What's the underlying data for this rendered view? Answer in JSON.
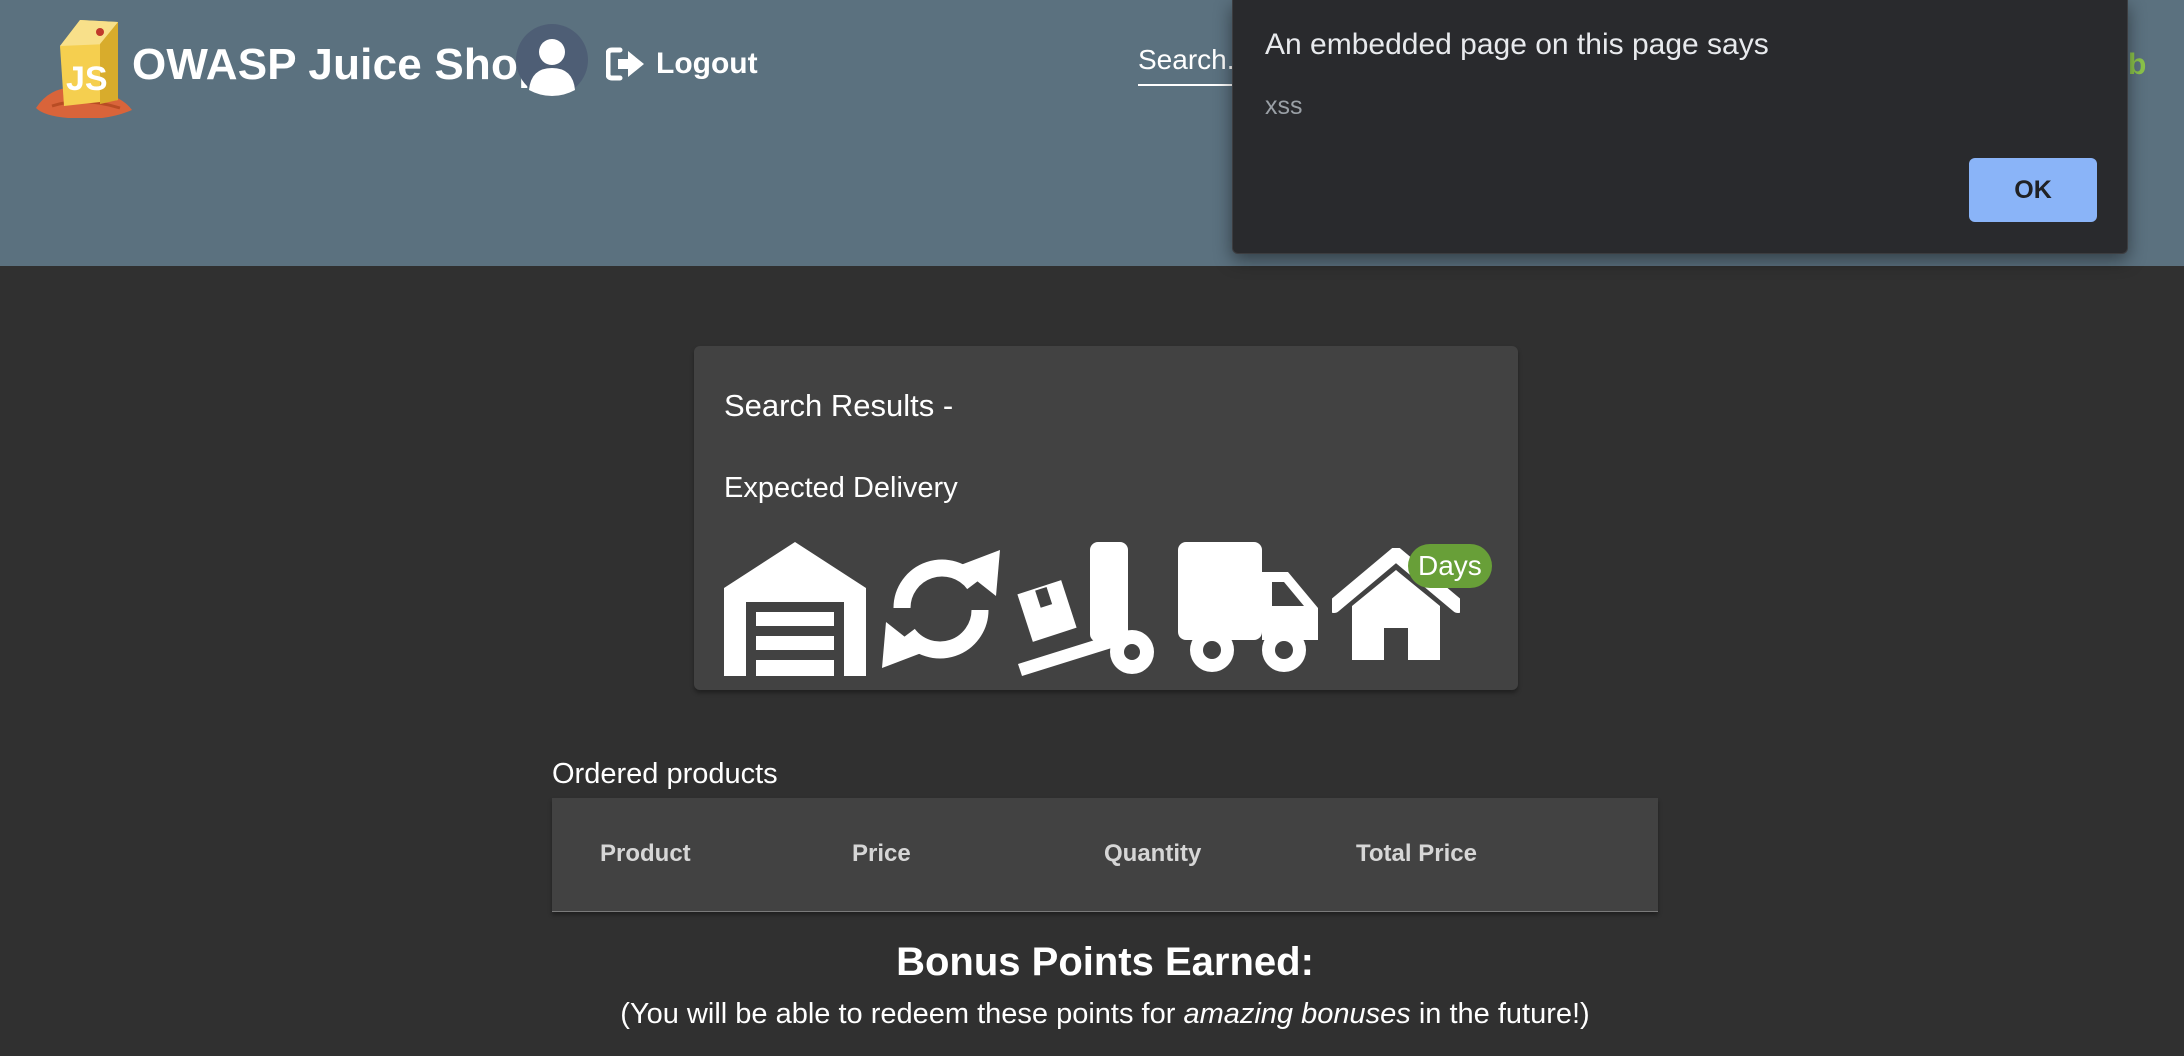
{
  "header": {
    "app_title": "OWASP Juice Shop",
    "logout_label": "Logout",
    "search_placeholder": "Search...",
    "partial_text": "b",
    "background_color": "#5b717f"
  },
  "alert": {
    "title": "An embedded page on this page says",
    "message": "xss",
    "ok_label": "OK",
    "ok_color": "#8ab4f8"
  },
  "search_results": {
    "title": "Search Results -",
    "delivery_label": "Expected Delivery",
    "days_badge": "Days",
    "badge_color": "#689f38",
    "icons": [
      "warehouse-icon",
      "sync-icon",
      "dolly-icon",
      "truck-icon",
      "home-icon"
    ]
  },
  "ordered_products": {
    "label": "Ordered products",
    "columns": [
      "Product",
      "Price",
      "Quantity",
      "Total Price"
    ]
  },
  "bonus": {
    "title": "Bonus Points Earned:",
    "note_prefix": "(You will be able to redeem these points for ",
    "note_emphasis": "amazing bonuses",
    "note_suffix": " in the future!)"
  }
}
